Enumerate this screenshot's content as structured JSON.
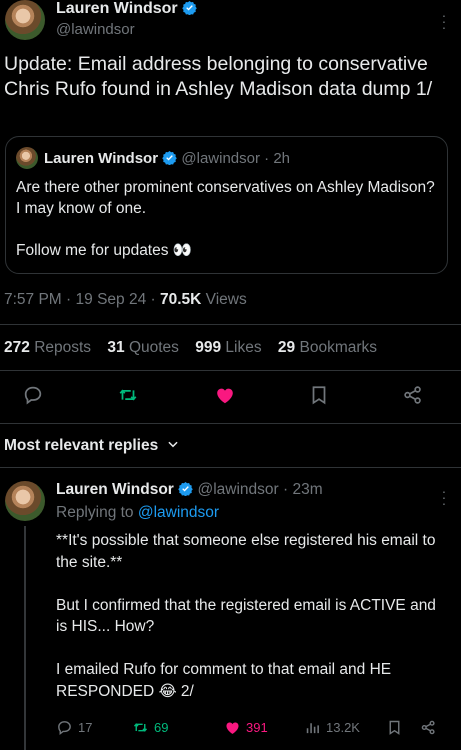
{
  "tweet": {
    "author_name": "Lauren Windsor",
    "author_handle": "@lawindsor",
    "text": "Update: Email address belonging to conservative Chris Rufo found in Ashley Madison data dump  1/",
    "time": "7:57 PM",
    "date": "19 Sep 24",
    "views": "70.5K",
    "views_label": "Views"
  },
  "quote": {
    "author_name": "Lauren Windsor",
    "author_handle": "@lawindsor",
    "age": "2h",
    "text": "Are there other prominent conservatives on Ashley Madison? I may know of one.\n\nFollow me for updates 👀"
  },
  "stats": {
    "reposts": "272",
    "reposts_label": "Reposts",
    "quotes": "31",
    "quotes_label": "Quotes",
    "likes": "999",
    "likes_label": "Likes",
    "bookmarks": "29",
    "bookmarks_label": "Bookmarks"
  },
  "replies_header": "Most relevant replies",
  "reply": {
    "author_name": "Lauren Windsor",
    "author_handle": "@lawindsor",
    "age": "23m",
    "replying_prefix": "Replying to",
    "replying_to": "@lawindsor",
    "text": "**It's possible that someone else registered his email to the site.**\n\nBut I confirmed that the registered email is ACTIVE and is HIS... How?\n\nI emailed Rufo for comment to that email and HE RESPONDED 😂   2/",
    "replies": "17",
    "reposts": "69",
    "likes": "391",
    "views": "13.2K"
  },
  "colors": {
    "background": "#000000",
    "text": "#e7e9ea",
    "muted": "#71767b",
    "accent_blue": "#1d9bf0",
    "repost_green": "#00ba7c",
    "like_pink": "#f91880",
    "border": "#2f3336"
  }
}
